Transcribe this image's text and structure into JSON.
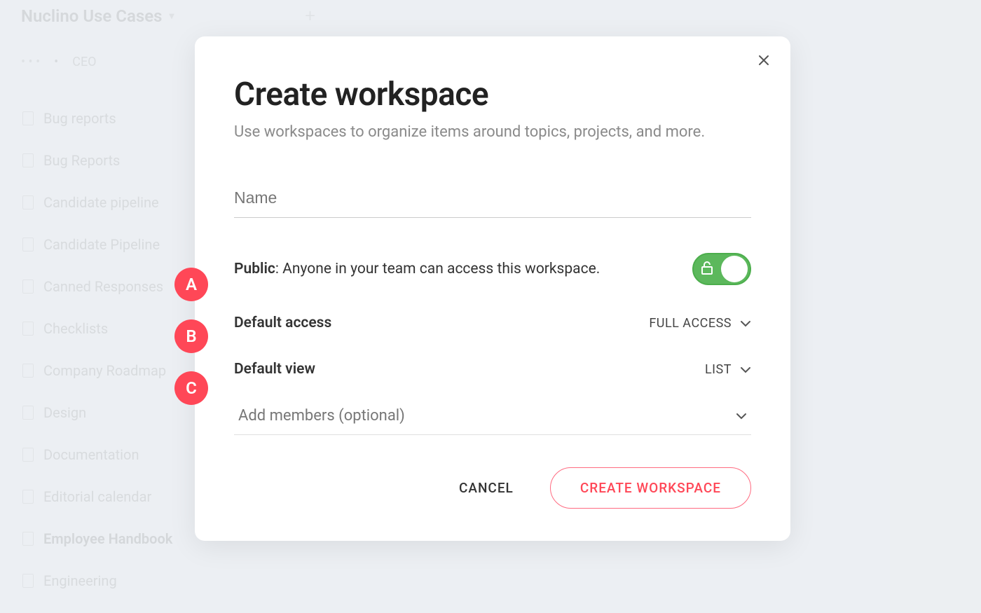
{
  "background": {
    "workspace_title": "Nuclino Use Cases",
    "breadcrumb_dots": "• • •",
    "breadcrumb_ceo": "CEO",
    "items": [
      {
        "label": "Bug reports"
      },
      {
        "label": "Bug Reports"
      },
      {
        "label": "Candidate pipeline"
      },
      {
        "label": "Candidate Pipeline"
      },
      {
        "label": "Canned Responses"
      },
      {
        "label": "Checklists"
      },
      {
        "label": "Company Roadmap"
      },
      {
        "label": "Design"
      },
      {
        "label": "Documentation"
      },
      {
        "label": "Editorial calendar"
      },
      {
        "label": "Employee Handbook"
      },
      {
        "label": "Engineering"
      }
    ]
  },
  "modal": {
    "title": "Create workspace",
    "subtitle": "Use workspaces to organize items around topics, projects, and more.",
    "name_placeholder": "Name",
    "public": {
      "label_bold": "Public",
      "label_rest": ": Anyone in your team can access this workspace.",
      "enabled": true
    },
    "default_access": {
      "label": "Default access",
      "value": "FULL ACCESS"
    },
    "default_view": {
      "label": "Default view",
      "value": "LIST"
    },
    "members_placeholder": "Add members (optional)",
    "buttons": {
      "cancel": "CANCEL",
      "create": "CREATE WORKSPACE"
    }
  },
  "annotations": {
    "a": "A",
    "b": "B",
    "c": "C"
  }
}
